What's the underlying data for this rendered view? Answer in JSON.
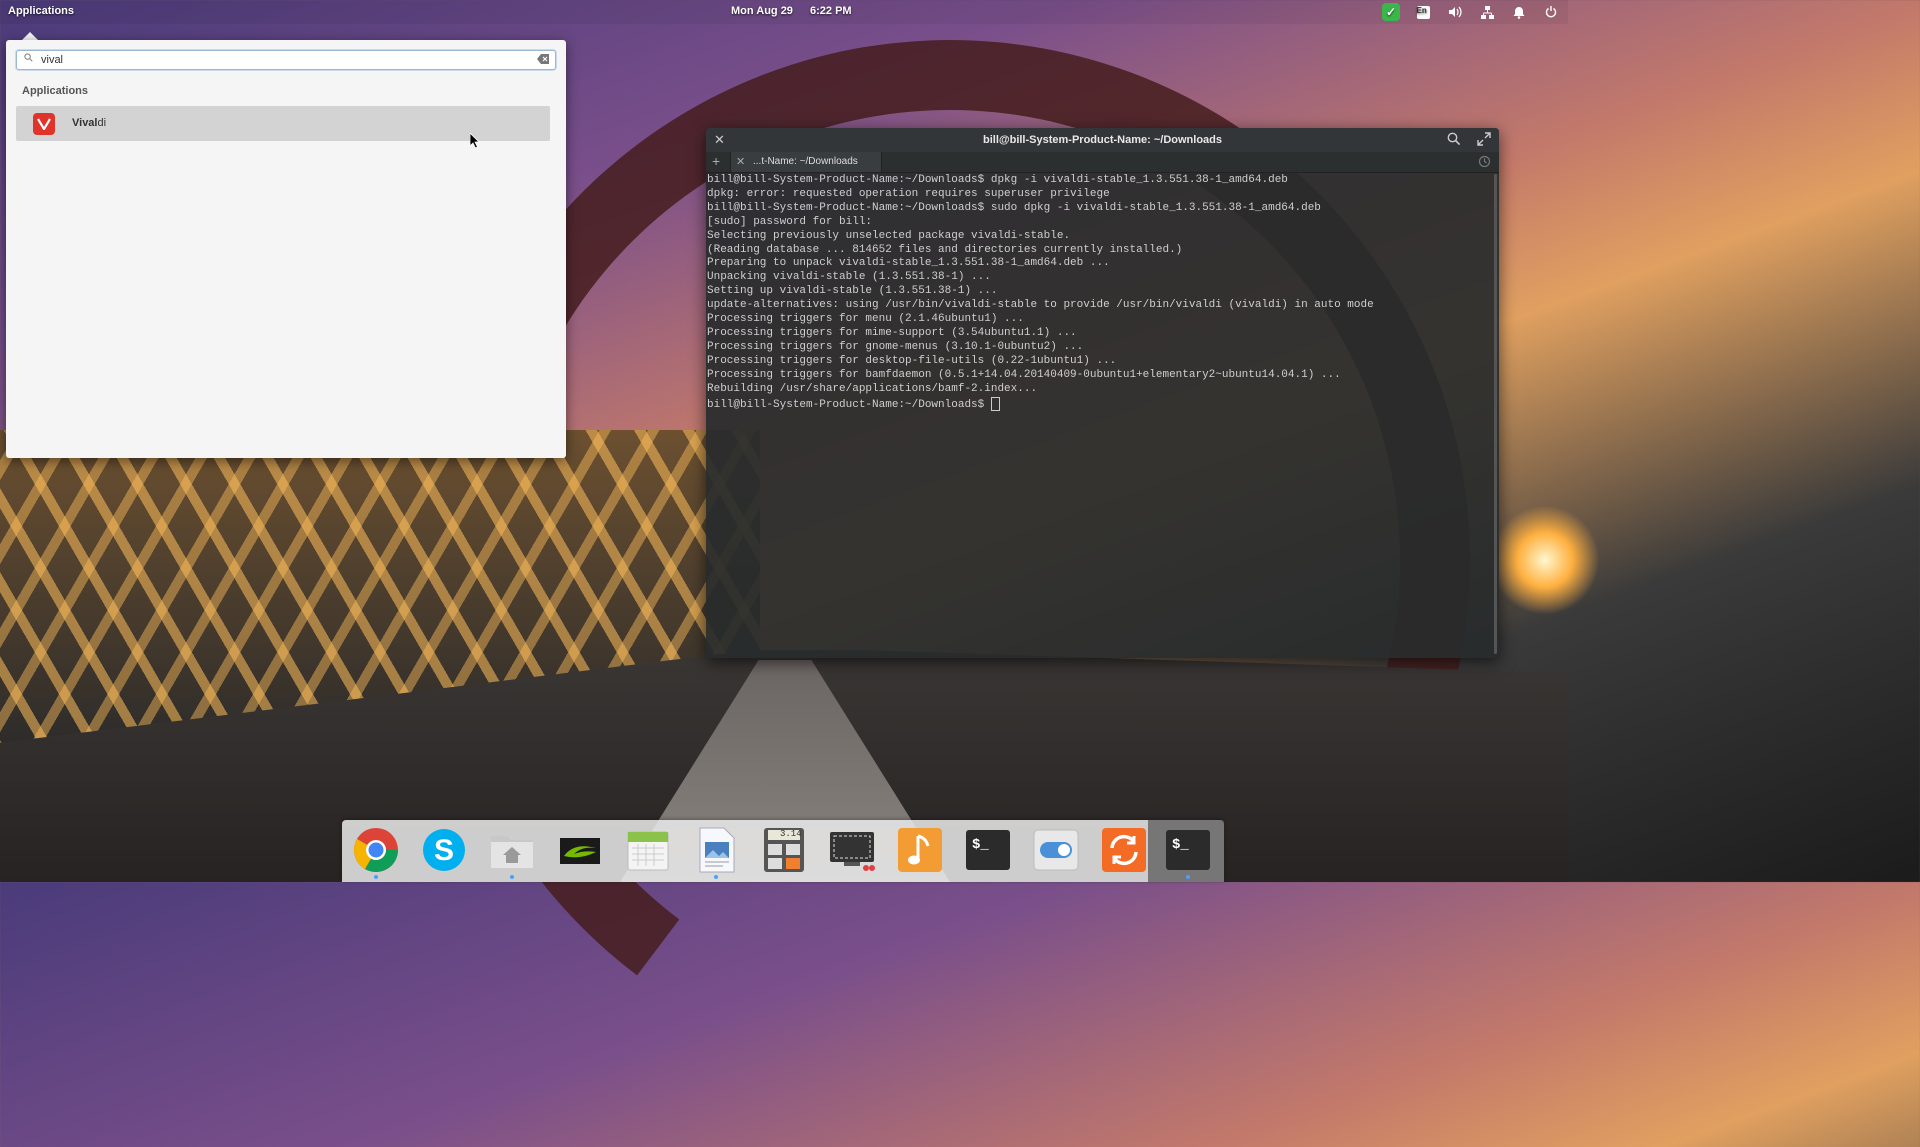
{
  "top_panel": {
    "applications_label": "Applications",
    "date": "Mon Aug 29",
    "time": "6:22 PM",
    "indicators": [
      {
        "name": "check-indicator-icon"
      },
      {
        "name": "keyboard-layout-icon",
        "text": "En"
      },
      {
        "name": "volume-icon"
      },
      {
        "name": "network-icon"
      },
      {
        "name": "notifications-icon"
      },
      {
        "name": "power-icon"
      }
    ]
  },
  "app_menu": {
    "search_value": "vival",
    "section_title": "Applications",
    "results": [
      {
        "label_match": "Vival",
        "label_rest": "di"
      }
    ]
  },
  "terminal": {
    "title": "bill@bill-System-Product-Name: ~/Downloads",
    "tab_label": "...t-Name: ~/Downloads",
    "lines": [
      "bill@bill-System-Product-Name:~/Downloads$ dpkg -i vivaldi-stable_1.3.551.38-1_amd64.deb",
      "dpkg: error: requested operation requires superuser privilege",
      "bill@bill-System-Product-Name:~/Downloads$ sudo dpkg -i vivaldi-stable_1.3.551.38-1_amd64.deb",
      "[sudo] password for bill:",
      "Selecting previously unselected package vivaldi-stable.",
      "(Reading database ... 814652 files and directories currently installed.)",
      "Preparing to unpack vivaldi-stable_1.3.551.38-1_amd64.deb ...",
      "Unpacking vivaldi-stable (1.3.551.38-1) ...",
      "Setting up vivaldi-stable (1.3.551.38-1) ...",
      "update-alternatives: using /usr/bin/vivaldi-stable to provide /usr/bin/vivaldi (vivaldi) in auto mode",
      "Processing triggers for menu (2.1.46ubuntu1) ...",
      "Processing triggers for mime-support (3.54ubuntu1.1) ...",
      "Processing triggers for gnome-menus (3.10.1-0ubuntu2) ...",
      "Processing triggers for desktop-file-utils (0.22-1ubuntu1) ...",
      "Processing triggers for bamfdaemon (0.5.1+14.04.20140409-0ubuntu1+elementary2~ubuntu14.04.1) ...",
      "Rebuilding /usr/share/applications/bamf-2.index..."
    ],
    "prompt": "bill@bill-System-Product-Name:~/Downloads$ "
  },
  "dock": {
    "calculator_display": "3.14",
    "items": [
      {
        "name": "chrome-icon",
        "running": true
      },
      {
        "name": "skype-icon",
        "running": false
      },
      {
        "name": "files-icon",
        "running": true
      },
      {
        "name": "nvidia-icon",
        "running": false
      },
      {
        "name": "calendar-icon",
        "running": false
      },
      {
        "name": "document-viewer-icon",
        "running": true
      },
      {
        "name": "calculator-icon",
        "running": false
      },
      {
        "name": "screenshot-icon",
        "running": false
      },
      {
        "name": "music-icon",
        "running": false
      },
      {
        "name": "terminal-icon",
        "running": false
      },
      {
        "name": "switchboard-icon",
        "running": false
      },
      {
        "name": "software-updater-icon",
        "running": false
      },
      {
        "name": "terminal-active-icon",
        "running": true
      }
    ]
  },
  "colors": {
    "vivaldi_red": "#e0332a",
    "dock_indicator": "#4aa0ff",
    "terminal_bg": "#282b2c"
  }
}
